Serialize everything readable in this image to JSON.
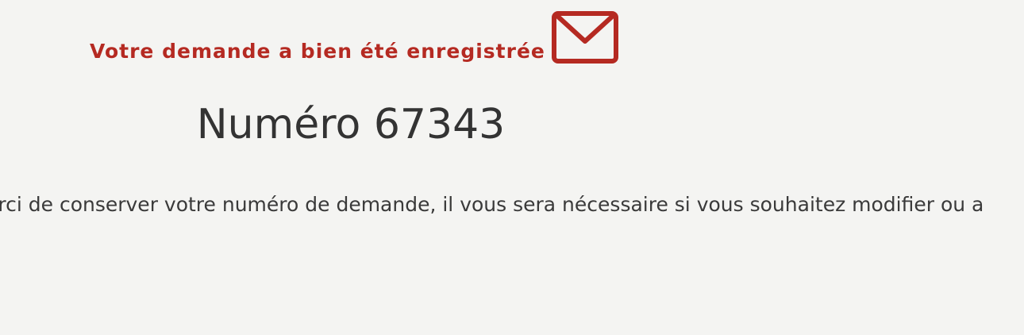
{
  "confirmation": {
    "title": "Votre demande a bien été enregistrée",
    "icon": "mail-icon",
    "accent_color": "#b52a22"
  },
  "request": {
    "number_label": "Numéro 67343"
  },
  "notice": {
    "text": "erci de conserver votre numéro de demande, il vous sera nécessaire si vous souhaitez modifier ou a"
  }
}
